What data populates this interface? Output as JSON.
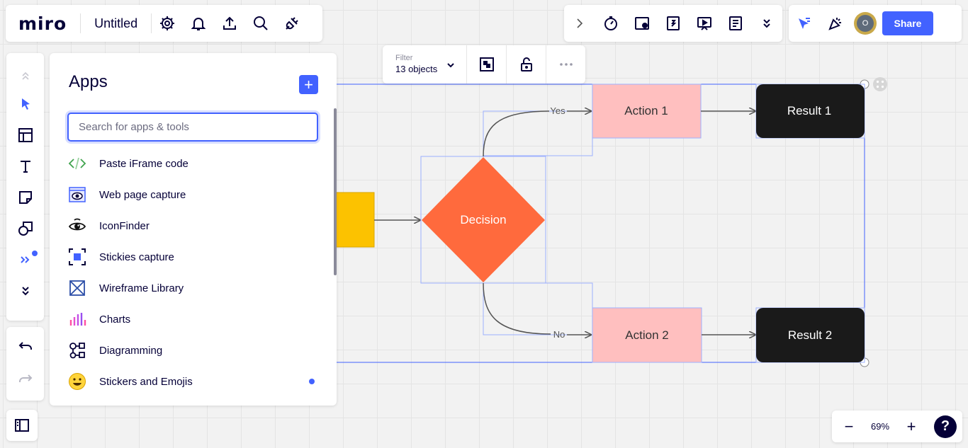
{
  "header": {
    "logo": "miro",
    "board_title": "Untitled",
    "icons": [
      "gear-icon",
      "bell-icon",
      "upload-icon",
      "search-icon",
      "plug-icon"
    ]
  },
  "top_right": {
    "tools": [
      "chevron-right-icon",
      "timer-icon",
      "voting-icon",
      "frames-icon",
      "presentation-icon",
      "notes-icon",
      "chevron-double-down-icon"
    ],
    "collab": [
      "cursor-icon",
      "celebrate-icon"
    ],
    "avatar_initial": "O",
    "share_label": "Share"
  },
  "left_toolbar": {
    "tools": [
      "collapse-up-icon",
      "select-icon",
      "templates-icon",
      "text-icon",
      "sticky-note-icon",
      "shapes-icon",
      "more-apps-icon",
      "chevron-double-down-icon"
    ]
  },
  "apps_panel": {
    "title": "Apps",
    "add_label": "+",
    "search_placeholder": "Search for apps & tools",
    "items": [
      {
        "label": "Paste iFrame code",
        "icon": "code-icon"
      },
      {
        "label": "Web page capture",
        "icon": "webpage-eye-icon"
      },
      {
        "label": "IconFinder",
        "icon": "iconfinder-icon"
      },
      {
        "label": "Stickies capture",
        "icon": "stickies-capture-icon"
      },
      {
        "label": "Wireframe Library",
        "icon": "wireframe-icon"
      },
      {
        "label": "Charts",
        "icon": "charts-icon"
      },
      {
        "label": "Diagramming",
        "icon": "diagramming-icon"
      },
      {
        "label": "Stickers and Emojis",
        "icon": "smiley-icon"
      }
    ]
  },
  "filter_bar": {
    "filter_label": "Filter",
    "filter_value": "13 objects"
  },
  "diagram": {
    "decision": "Decision",
    "action1": "Action 1",
    "action2": "Action 2",
    "result1": "Result 1",
    "result2": "Result 2",
    "yes": "Yes",
    "no": "No"
  },
  "colors": {
    "accent": "#4262ff",
    "decision": "#ff6a3d",
    "action": "#ffbfbf",
    "result": "#1a1a1a",
    "start": "#fcc200"
  },
  "zoom": {
    "out_label": "−",
    "level": "69%",
    "in_label": "+",
    "help_label": "?"
  }
}
